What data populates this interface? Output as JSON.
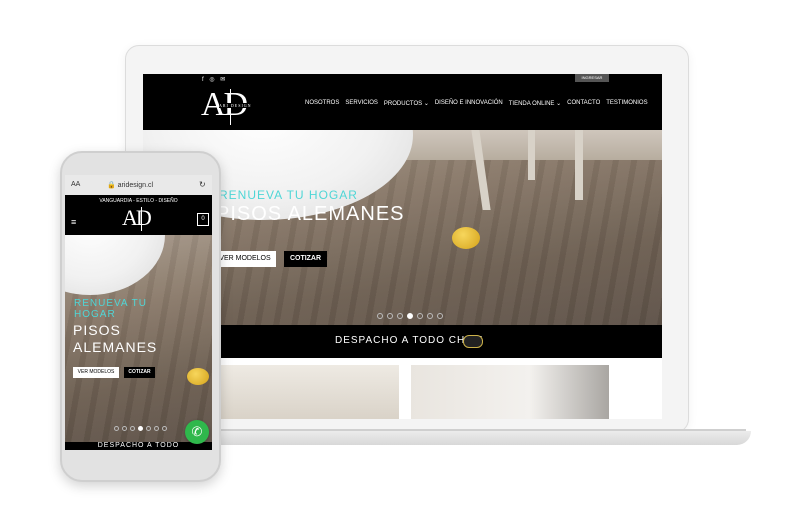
{
  "site": {
    "logo_text": "AD",
    "logo_sub": "ARI DESIGN"
  },
  "laptop": {
    "social_icons": "f ◎ ✉",
    "login_label": "INGRESAR",
    "nav": [
      {
        "label": "NOSOTROS"
      },
      {
        "label": "SERVICIOS"
      },
      {
        "label": "PRODUCTOS ⌄"
      },
      {
        "label": "DISEÑO E INNOVACIÓN"
      },
      {
        "label": "TIENDA ONLINE ⌄"
      },
      {
        "label": "CONTACTO"
      },
      {
        "label": "TESTIMONIOS"
      }
    ],
    "hero": {
      "subtitle": "RENUEVA TU HOGAR",
      "title": "PISOS ALEMANES",
      "btn_models": "VER MODELOS",
      "btn_quote": "COTIZAR",
      "slides_total": 8,
      "slide_active": 4
    },
    "strip": "DESPACHO A TODO CHILE"
  },
  "phone": {
    "text_size": "AA",
    "url": "🔒 aridesign.cl",
    "reload": "↻",
    "tagline": "VANGUARDIA - ESTILO - DISEÑO",
    "menu_icon": "≡",
    "cart_count": "0",
    "hero": {
      "subtitle_1": "RENUEVA TU",
      "subtitle_2": "HOGAR",
      "title_1": "PISOS",
      "title_2": "ALEMANES",
      "btn_models": "VER MODELOS",
      "btn_quote": "COTIZAR"
    },
    "strip": "DESPACHO A TODO",
    "whatsapp_icon": "✆"
  },
  "colors": {
    "accent_cyan": "#4fd6d6",
    "header_black": "#000000",
    "whatsapp_green": "#2fb84c"
  }
}
